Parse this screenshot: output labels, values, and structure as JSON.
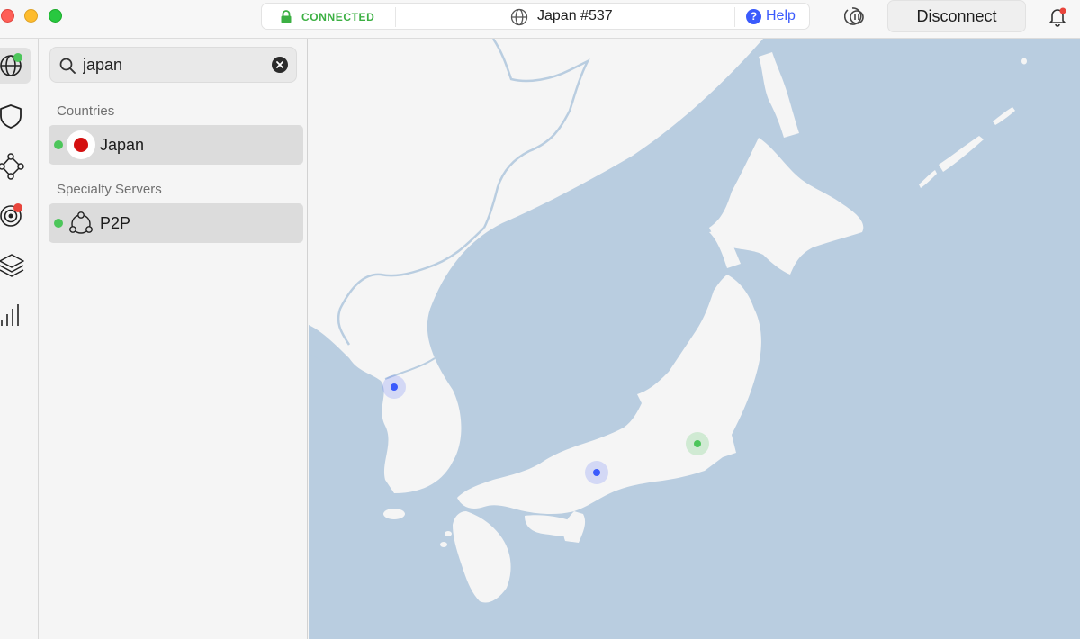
{
  "titlebar": {
    "status": "CONNECTED",
    "server": "Japan #537",
    "help_label": "Help",
    "disconnect_label": "Disconnect"
  },
  "search": {
    "value": "japan",
    "placeholder": "Search"
  },
  "sections": {
    "countries_label": "Countries",
    "specialty_label": "Specialty Servers"
  },
  "results": {
    "country": {
      "name": "Japan",
      "status": "online"
    },
    "specialty": {
      "name": "P2P",
      "status": "online"
    }
  },
  "rail_icons": [
    "globe-icon",
    "shield-icon",
    "meshnet-icon",
    "threat-protection-icon",
    "layers-icon",
    "stats-icon"
  ],
  "colors": {
    "connected_green": "#3cb043",
    "accent_blue": "#3b5bfc",
    "sea": "#b9cde0",
    "land": "#f5f5f5",
    "notification_red": "#e8453c"
  }
}
